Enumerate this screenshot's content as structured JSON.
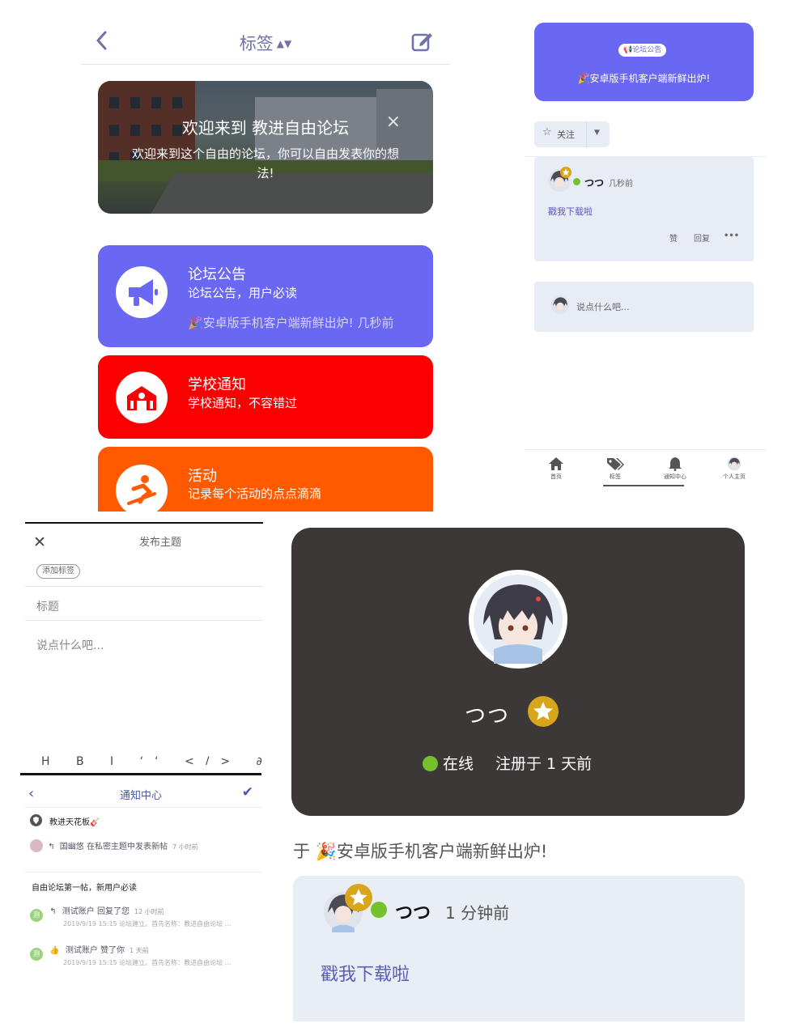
{
  "tags_page": {
    "title": "标签",
    "banner": {
      "title": "欢迎来到 教进自由论坛",
      "description": "欢迎来到这个自由的论坛，你可以自由发表你的想法!",
      "close": "×"
    },
    "categories": [
      {
        "name": "论坛公告",
        "description": "论坛公告，用户必读",
        "last_post": "🎉安卓版手机客户端新鲜出炉!",
        "last_time": "几秒前",
        "color": "#6a67f3"
      },
      {
        "name": "学校通知",
        "description": "学校通知，不容错过",
        "color": "#fa0000"
      },
      {
        "name": "活动",
        "description": "记录每个活动的点点滴滴",
        "color": "#ff5a00"
      }
    ]
  },
  "announcement_page": {
    "badge": "📢论坛公告",
    "title": "🎉安卓版手机客户端新鲜出炉!",
    "follow_label": "关注",
    "post": {
      "user": "つつ",
      "time": "几秒前",
      "body": "戳我下载啦",
      "actions": [
        "赞",
        "回复",
        "•••"
      ]
    },
    "reply_placeholder": "说点什么吧...",
    "tabbar": [
      {
        "label": "首页",
        "icon": "home-icon"
      },
      {
        "label": "标签",
        "icon": "tag-icon"
      },
      {
        "label": "通知中心",
        "icon": "bell-icon"
      },
      {
        "label": "个人主页",
        "icon": "avatar-icon"
      }
    ]
  },
  "compose_page": {
    "title": "发布主题",
    "add_tag": "添加标签",
    "title_placeholder": "标题",
    "body_placeholder": "说点什么吧...",
    "toolbar": "H B I ‘‘ </> ∂ ▣ ☰ ☰ @ ◎"
  },
  "notification_page": {
    "title": "通知中心",
    "groups": [
      {
        "title": "教进天花板🎸",
        "items": [
          {
            "text": "国幽悠 在私密主题中发表新帖",
            "ago": "7 小时前"
          }
        ]
      },
      {
        "title": "自由论坛第一帖，新用户必读",
        "items": [
          {
            "text": "测试账户 回复了您",
            "ago": "12 小时前",
            "sub": "2019/9/19 15:15 论坛建立。首先名称：教进自由论坛 ..."
          },
          {
            "text": "测试账户 赞了你",
            "ago": "1 天前",
            "sub": "2019/9/19 15:15 论坛建立。首先名称：教进自由论坛 ..."
          }
        ]
      }
    ]
  },
  "profile_page": {
    "name": "つつ",
    "status": "在线",
    "registered": "注册于 1 天前",
    "topic_heading": "于 🎉安卓版手机客户端新鲜出炉!",
    "post": {
      "user": "つつ",
      "time": "1 分钟前",
      "body": "戳我下载啦"
    }
  },
  "colors": {
    "accent_purple": "#6a67f3",
    "school_red": "#fa0000",
    "activity_orange": "#ff5a00",
    "profile_dark": "#3c3838",
    "online_green": "#72c12d",
    "badge_gold": "#d9a51a"
  }
}
